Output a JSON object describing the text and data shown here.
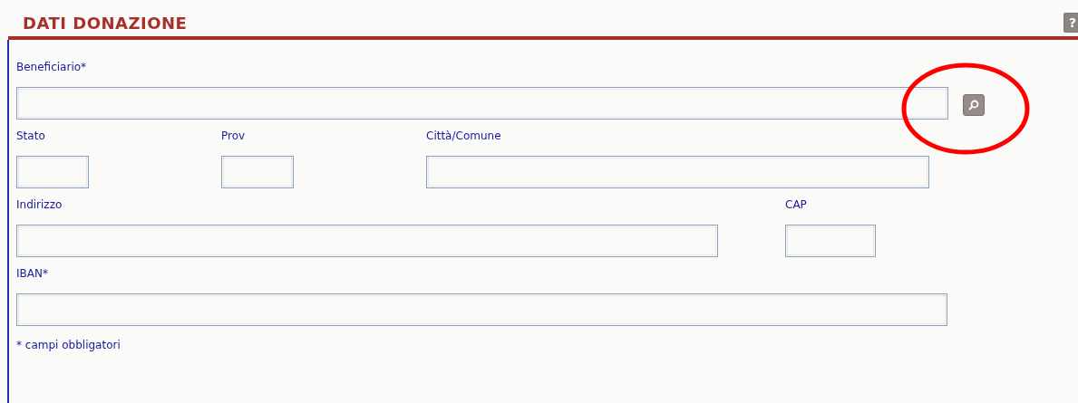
{
  "section": {
    "title": "DATI DONAZIONE",
    "help_button": "?"
  },
  "rows": [
    [
      {
        "label": "Beneficiario*",
        "lookup": true
      }
    ],
    [
      {
        "label": "Stato"
      },
      {
        "label": "Prov"
      },
      {
        "label": "Città/Comune"
      }
    ],
    [
      {
        "label": "Indirizzo"
      },
      {
        "label": "CAP"
      }
    ],
    [
      {
        "label": "IBAN*"
      }
    ]
  ],
  "footnote": "* campi obbligatori",
  "annotation": {
    "kind": "circle",
    "color": "#ff0000"
  }
}
